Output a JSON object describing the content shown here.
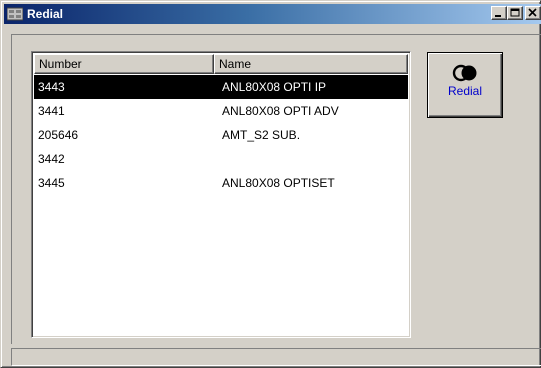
{
  "window": {
    "title": "Redial",
    "minimize_glyph": "_",
    "maximize_glyph": "□",
    "close_glyph": "×"
  },
  "list": {
    "columns": [
      "Number",
      "Name"
    ],
    "rows": [
      {
        "number": "3443",
        "name": "ANL80X08 OPTI IP",
        "selected": true
      },
      {
        "number": "3441",
        "name": "ANL80X08 OPTI ADV",
        "selected": false
      },
      {
        "number": "205646",
        "name": "AMT_S2 SUB.",
        "selected": false
      },
      {
        "number": "3442",
        "name": "",
        "selected": false
      },
      {
        "number": "3445",
        "name": "ANL80X08 OPTISET",
        "selected": false
      }
    ]
  },
  "actions": {
    "redial_label": "Redial",
    "redial_icon": "redial-icon"
  },
  "colors": {
    "titlebar_start": "#0a246a",
    "titlebar_end": "#a6caf0",
    "selection_bg": "#000000",
    "selection_fg": "#ffffff",
    "redial_label": "#0000cc",
    "face": "#d4d0c8"
  }
}
